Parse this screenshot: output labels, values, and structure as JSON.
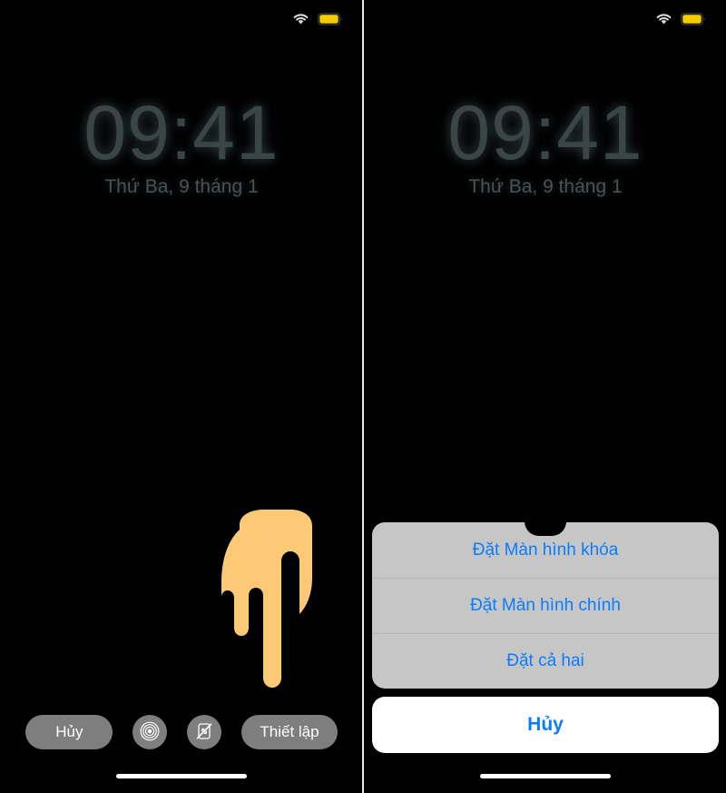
{
  "colors": {
    "screen_background": "#000000",
    "hand_pointer": "#fcca76",
    "clock_text": "#3b4548",
    "button_gray": "#7e7e7e",
    "sheet_background": "#c6c6c6",
    "sheet_text_blue": "#0a7cff",
    "battery_yellow": "#f5cc00",
    "home_indicator": "#ffffff",
    "divider": "#e9e9e9"
  },
  "left_phone": {
    "name": "wallpaper-preview-screen",
    "statusbar": {
      "wifi_icon": "wifi-icon",
      "battery_icon": "battery-low-power-icon"
    },
    "lockscreen": {
      "time": "09:41",
      "date": "Thứ Ba, 9 tháng 1"
    },
    "pointer": {
      "icon": "hand-pointer-icon"
    },
    "toolbar": {
      "cancel_label": "Hủy",
      "live_photo_icon": "live-photo-icon",
      "perspective_zoom_off_icon": "perspective-zoom-off-icon",
      "set_label": "Thiết lập"
    },
    "home_indicator": "home-indicator"
  },
  "right_phone": {
    "name": "wallpaper-set-action-sheet-screen",
    "statusbar": {
      "wifi_icon": "wifi-icon",
      "battery_icon": "battery-low-power-icon"
    },
    "lockscreen": {
      "time": "09:41",
      "date": "Thứ Ba, 9 tháng 1"
    },
    "pointer": {
      "icon": "hand-pointer-icon"
    },
    "action_sheet": {
      "options": [
        {
          "label": "Đặt Màn hình khóa"
        },
        {
          "label": "Đặt Màn hình chính"
        },
        {
          "label": "Đặt cả hai"
        }
      ],
      "cancel_label": "Hủy"
    },
    "home_indicator": "home-indicator"
  }
}
